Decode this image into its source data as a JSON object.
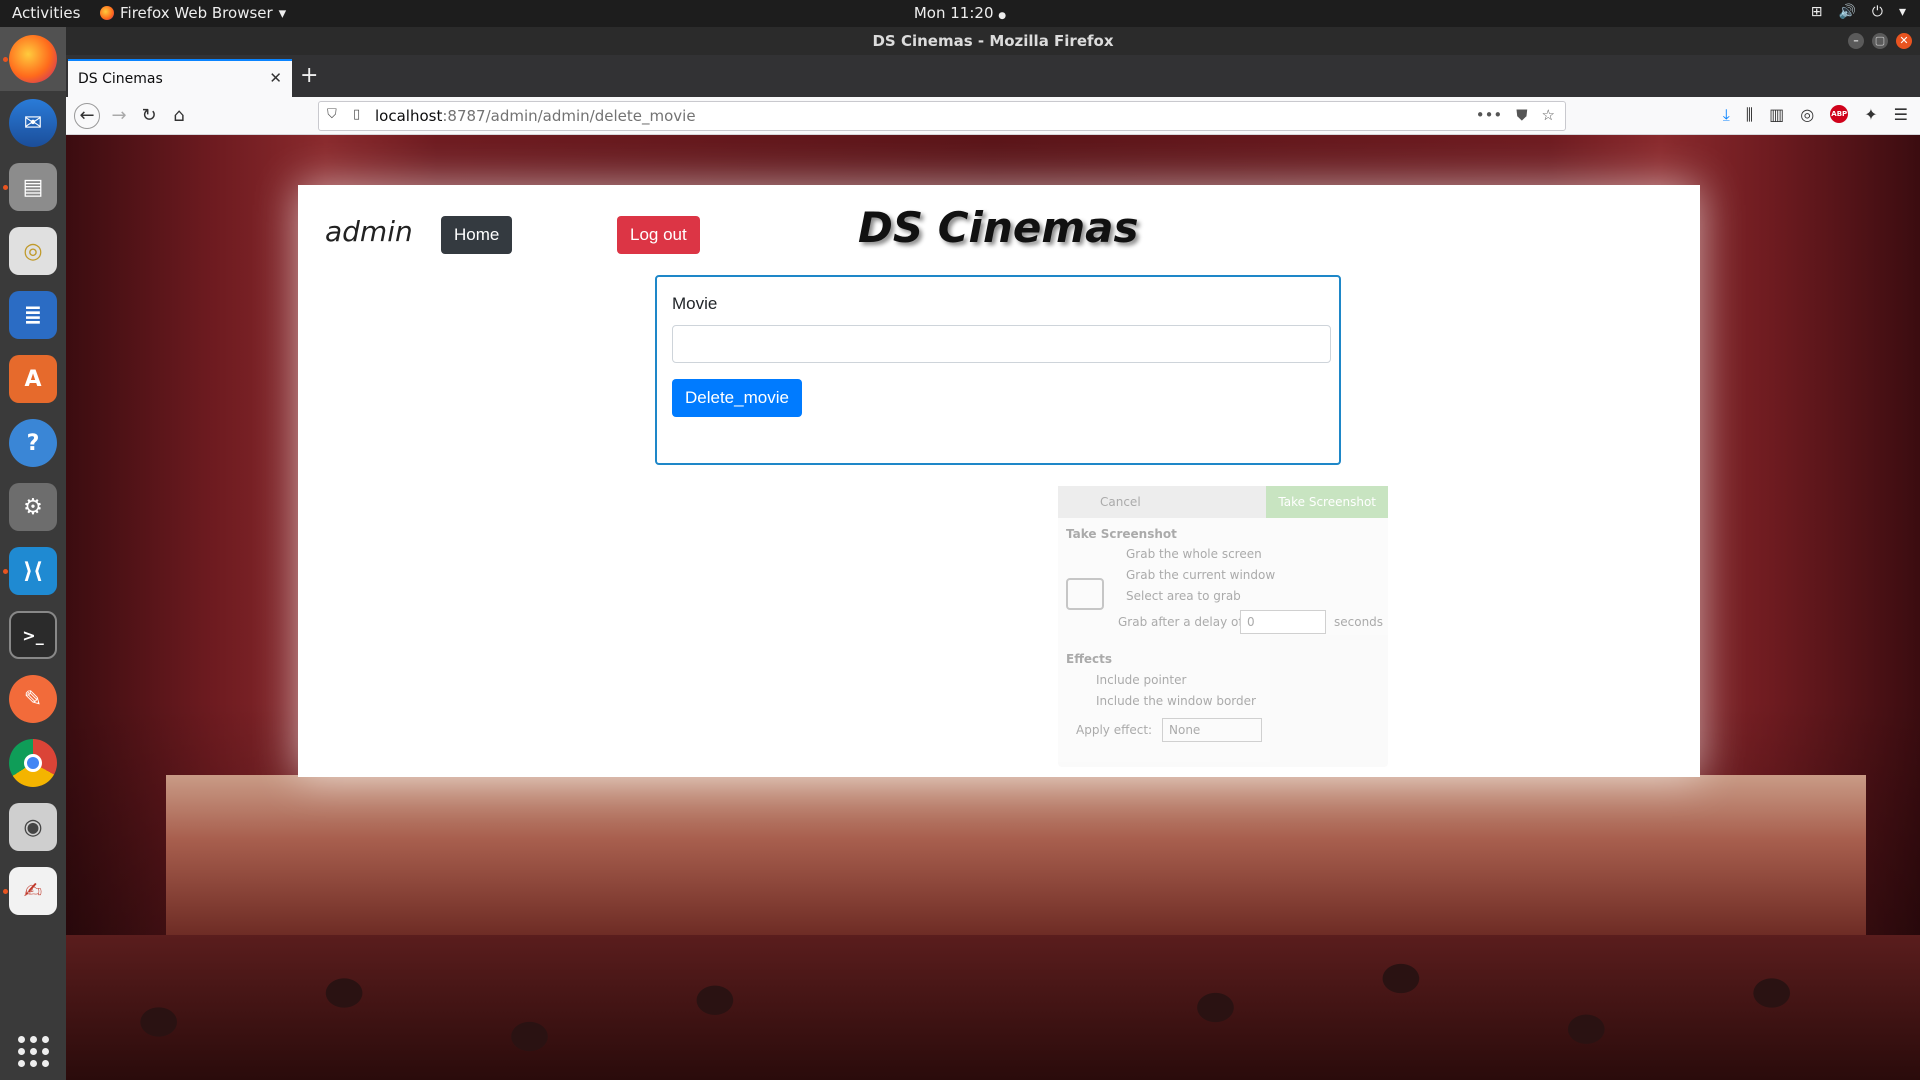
{
  "topbar": {
    "activities": "Activities",
    "app_name": "Firefox Web Browser",
    "app_menu_arrow": "▾",
    "clock": "Mon 11:20",
    "clock_dot": "●",
    "tray_network": "⊞",
    "tray_volume": "🔊",
    "tray_power": "⏻",
    "tray_arrow": "▾"
  },
  "dock": {
    "items": [
      "Firefox",
      "Thunderbird",
      "Files",
      "Rhythmbox",
      "LibreOffice Writer",
      "Ubuntu Software",
      "Help",
      "Settings",
      "Visual Studio Code",
      "Terminal",
      "Postman",
      "Chrome",
      "Screenshot",
      "Text Editor"
    ],
    "show_apps": "Show Applications"
  },
  "window": {
    "title": "DS Cinemas - Mozilla Firefox",
    "tab_title": "DS Cinemas",
    "tab_close": "✕",
    "new_tab": "+",
    "url_host": "localhost",
    "url_path": ":8787/admin/admin/delete_movie",
    "url_more": "•••"
  },
  "page": {
    "username": "admin",
    "home_label": "Home",
    "logout_label": "Log out",
    "site_title": "DS Cinemas",
    "form": {
      "label": "Movie",
      "input_value": "",
      "submit_label": "Delete_movie"
    }
  },
  "ghost_dialog": {
    "cancel": "Cancel",
    "take": "Take Screenshot",
    "section1": "Take Screenshot",
    "opt1": "Grab the whole screen",
    "opt2": "Grab the current window",
    "opt3": "Select area to grab",
    "delay_label": "Grab after a delay of",
    "delay_value": "0",
    "delay_unit": "seconds",
    "section2": "Effects",
    "eff1": "Include pointer",
    "eff2": "Include the window border",
    "apply_label": "Apply effect:",
    "apply_value": "None"
  },
  "colors": {
    "home_btn": "#343a40",
    "logout_btn": "#dc3545",
    "submit_btn": "#007bff",
    "form_border": "#1e87c8"
  }
}
